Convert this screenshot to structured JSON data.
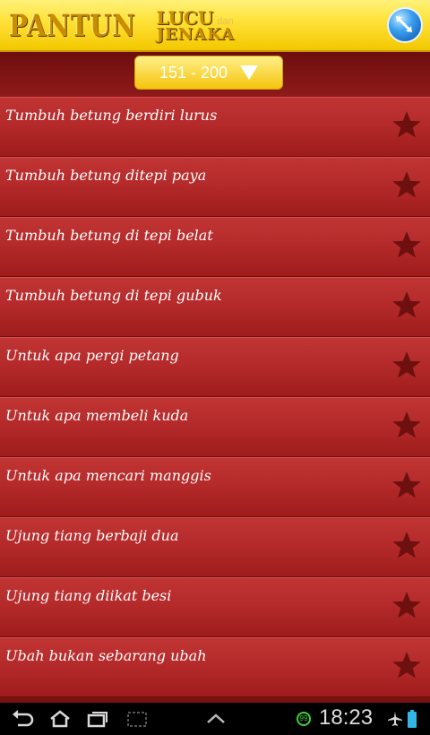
{
  "header": {
    "logo_main": "PANTUN",
    "logo_lucu": "LUCU",
    "logo_dan": "dan",
    "logo_jenaka": "JENAKA"
  },
  "range": {
    "label": "151 - 200"
  },
  "items": [
    {
      "title": "Tumbuh betung berdiri lurus"
    },
    {
      "title": "Tumbuh betung ditepi paya"
    },
    {
      "title": "Tumbuh betung di tepi belat"
    },
    {
      "title": "Tumbuh betung di tepi gubuk"
    },
    {
      "title": "Untuk apa pergi petang"
    },
    {
      "title": "Untuk apa membeli kuda"
    },
    {
      "title": "Untuk apa mencari manggis"
    },
    {
      "title": "Ujung tiang berbaji dua"
    },
    {
      "title": "Ujung tiang diikat besi"
    },
    {
      "title": "Ubah bukan sebarang ubah"
    }
  ],
  "statusbar": {
    "time": "18:23",
    "badge": "99"
  },
  "icons": {
    "globe": "globe-icon",
    "dropdown": "dropdown-triangle-icon",
    "favorite": "star-icon",
    "back": "back-icon",
    "home": "home-icon",
    "recent": "recent-apps-icon",
    "screenshot": "screenshot-icon",
    "menu": "menu-up-icon",
    "airplane": "airplane-icon",
    "battery": "battery-icon"
  },
  "colors": {
    "header": "#ffe23a",
    "list_item": "#b52a2a",
    "star": "#6e1010",
    "accent_green": "#3cd03c"
  }
}
